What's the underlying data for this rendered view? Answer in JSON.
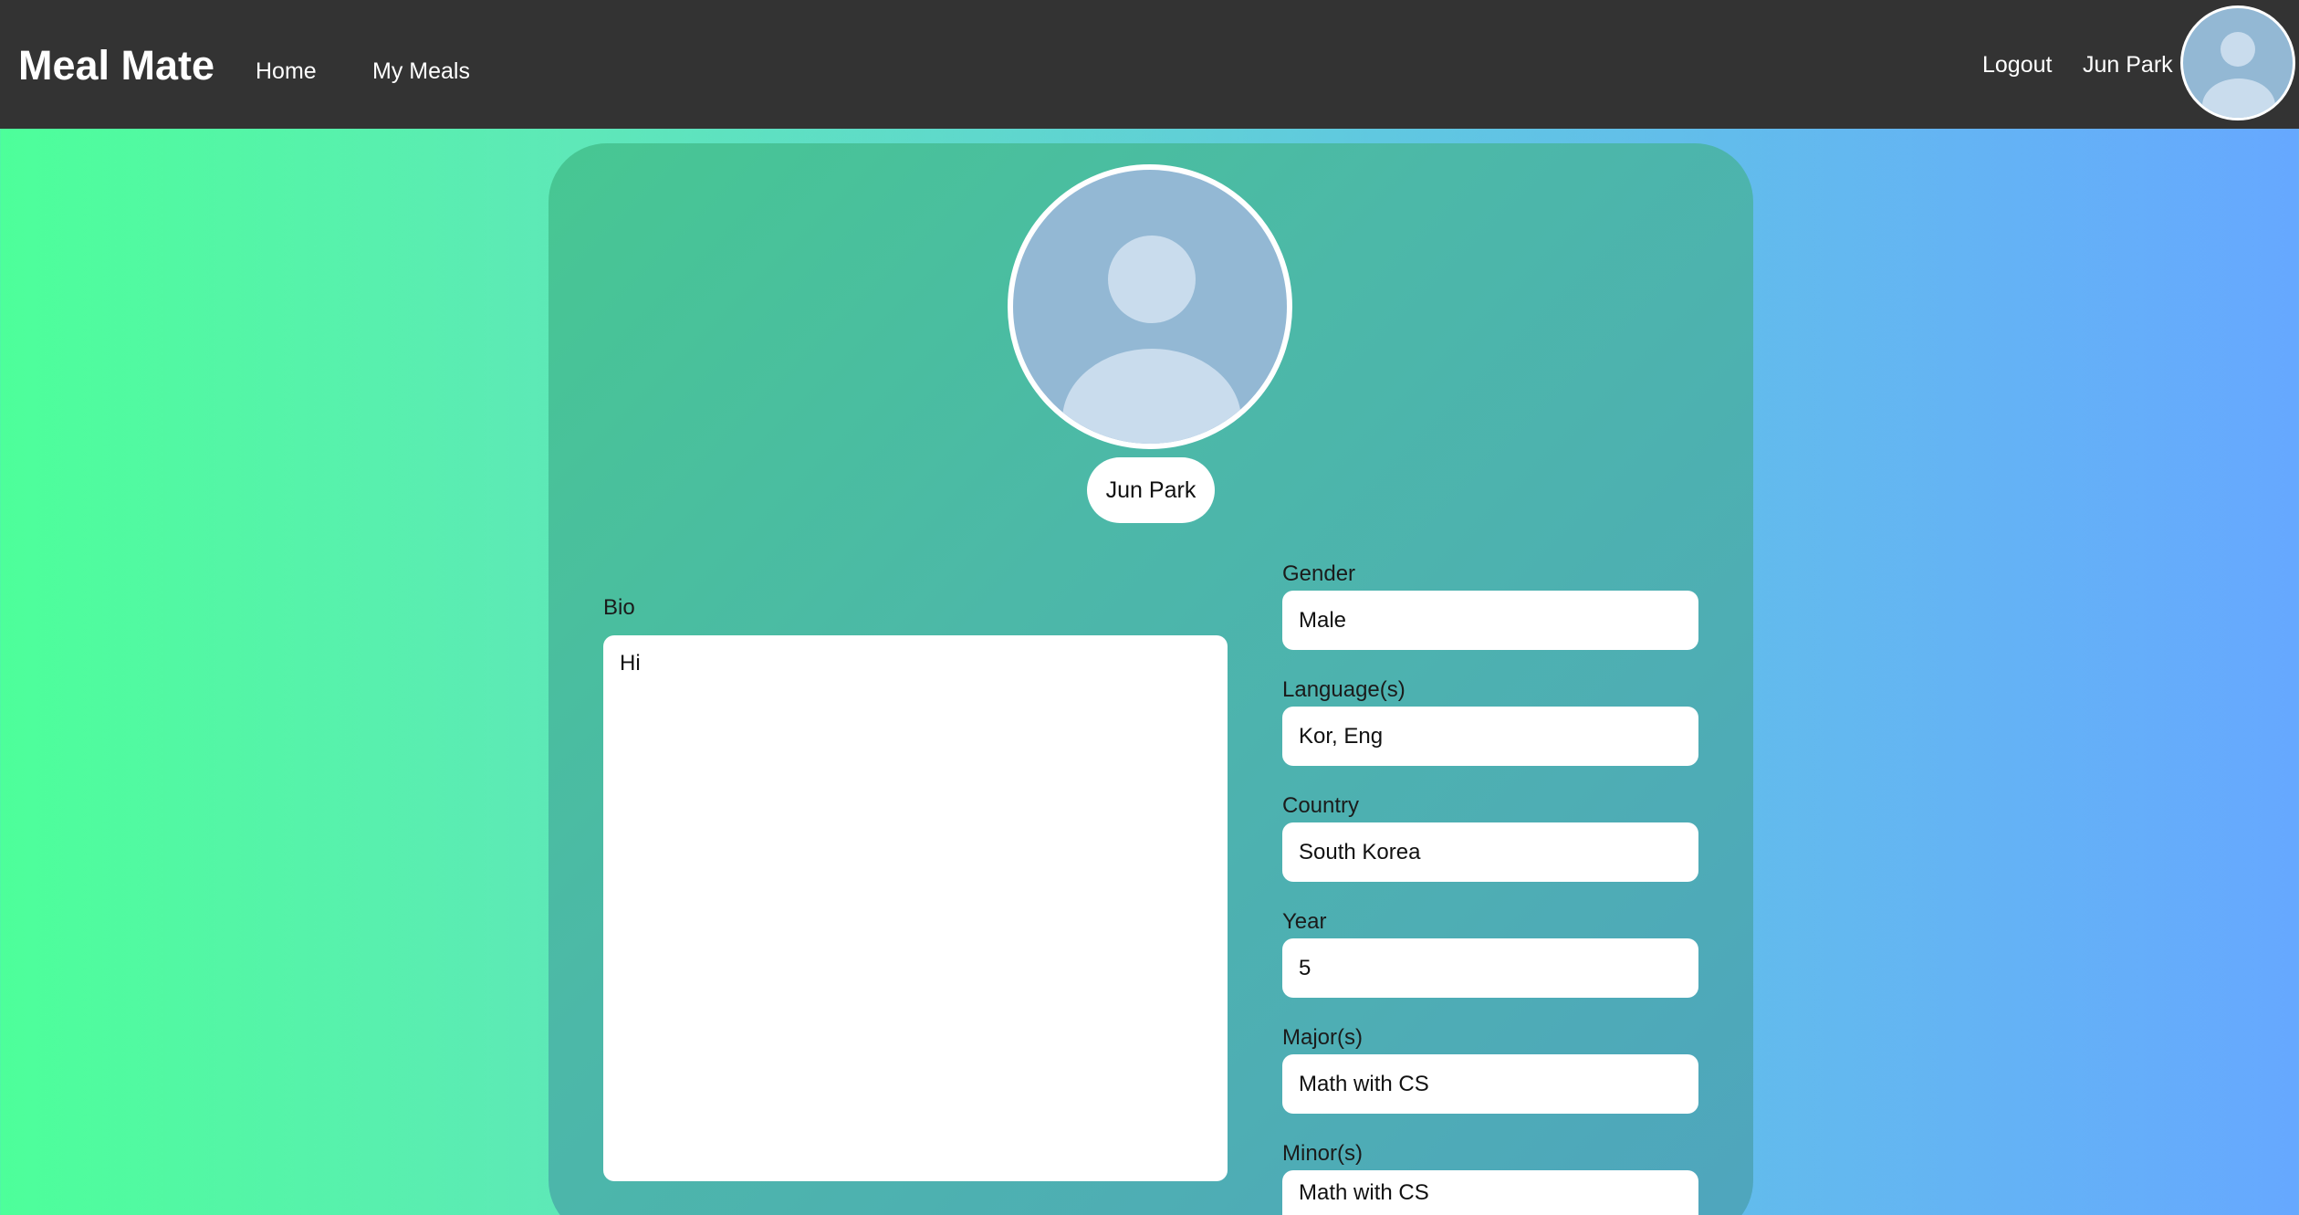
{
  "header": {
    "brand": "Meal Mate",
    "nav": {
      "home": "Home",
      "my_meals": "My Meals"
    },
    "logout": "Logout",
    "user_name": "Jun Park"
  },
  "profile": {
    "name": "Jun Park",
    "bio_label": "Bio",
    "bio": "Hi",
    "fields": {
      "gender": {
        "label": "Gender",
        "value": "Male"
      },
      "languages": {
        "label": "Language(s)",
        "value": "Kor, Eng"
      },
      "country": {
        "label": "Country",
        "value": "South Korea"
      },
      "year": {
        "label": "Year",
        "value": "5"
      },
      "majors": {
        "label": "Major(s)",
        "value": "Math with CS"
      },
      "minors": {
        "label": "Minor(s)",
        "value": "Math with CS"
      }
    }
  },
  "icons": {
    "nav_avatar": "user-avatar-icon",
    "profile_avatar": "user-avatar-icon"
  },
  "colors": {
    "navbar": "#333333",
    "background_left": "#4dff9a",
    "background_right": "#66a8ff",
    "card": "#4cb8a8",
    "avatar_bg": "#93b8d4"
  }
}
